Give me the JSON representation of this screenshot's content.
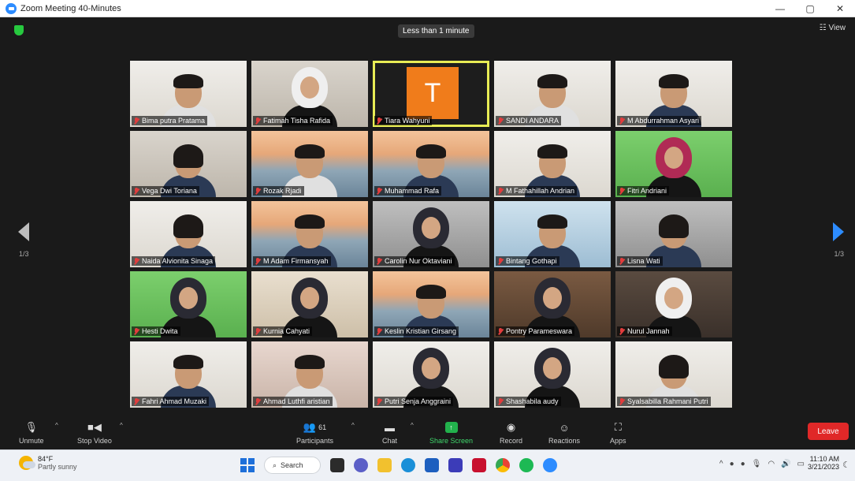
{
  "window": {
    "title": "Zoom Meeting 40-Minutes",
    "minimize": "—",
    "maximize": "▢",
    "close": "✕"
  },
  "meeting": {
    "timer": "Less than 1 minute",
    "view_label": "View",
    "page_left": "1/3",
    "page_right": "1/3"
  },
  "participants": [
    {
      "name": "Bima putra Pratama",
      "bg": "white",
      "look": "man"
    },
    {
      "name": "Fatimah Tisha Rafida",
      "bg": "room",
      "look": "hijab-white"
    },
    {
      "name": "Tiara Wahyuni",
      "bg": "orange",
      "look": "avatar",
      "avatar_letter": "T",
      "active": true
    },
    {
      "name": "SANDI ANDARA",
      "bg": "white",
      "look": "man"
    },
    {
      "name": "M Abdurrahman Asyari",
      "bg": "white",
      "look": "man"
    },
    {
      "name": "Vega Dwi Toriana",
      "bg": "room",
      "look": "woman"
    },
    {
      "name": "Rozak Rjadi",
      "bg": "bridge",
      "look": "man"
    },
    {
      "name": "Muhammad Rafa",
      "bg": "bridge",
      "look": "man"
    },
    {
      "name": "M Fathahillah Andrian",
      "bg": "white",
      "look": "man"
    },
    {
      "name": "Fitri Andriani",
      "bg": "green",
      "look": "hijab-pink"
    },
    {
      "name": "Naida Alvionita Sinaga",
      "bg": "white",
      "look": "woman"
    },
    {
      "name": "M Adam Firmansyah",
      "bg": "bridge",
      "look": "man"
    },
    {
      "name": "Carolin Nur Oktaviani",
      "bg": "gray",
      "look": "hijab"
    },
    {
      "name": "Bintang Gothapi",
      "bg": "blue",
      "look": "man"
    },
    {
      "name": "Lisna Wati",
      "bg": "gray",
      "look": "woman"
    },
    {
      "name": "Hesti Dwita",
      "bg": "green",
      "look": "hijab"
    },
    {
      "name": "Kurnia Cahyati",
      "bg": "beige",
      "look": "hijab"
    },
    {
      "name": "Keslin Kristian Girsang",
      "bg": "bridge",
      "look": "man"
    },
    {
      "name": "Pontry Parameswara",
      "bg": "brown",
      "look": "hijab"
    },
    {
      "name": "Nurul Jannah",
      "bg": "dark",
      "look": "hijab-white"
    },
    {
      "name": "Fahri Ahmad Muzaki",
      "bg": "white",
      "look": "man"
    },
    {
      "name": "Ahmad Luthfi aristian",
      "bg": "pink",
      "look": "man"
    },
    {
      "name": "Putri Senja Anggraini",
      "bg": "white",
      "look": "hijab"
    },
    {
      "name": "Shashabila audy",
      "bg": "white",
      "look": "hijab"
    },
    {
      "name": "Syalsabilla Rahmani Putri",
      "bg": "white",
      "look": "woman"
    }
  ],
  "toolbar": {
    "unmute": "Unmute",
    "stop_video": "Stop Video",
    "participants": "Participants",
    "participants_count": "61",
    "chat": "Chat",
    "share_screen": "Share Screen",
    "record": "Record",
    "reactions": "Reactions",
    "apps": "Apps",
    "leave": "Leave"
  },
  "taskbar": {
    "temperature": "84°F",
    "condition": "Partly sunny",
    "search": "Search",
    "time": "11:10 AM",
    "date": "3/21/2023"
  },
  "colors": {
    "zoom_blue": "#2D8CFF",
    "active_speaker": "#e8ec55",
    "leave_red": "#e02828",
    "share_green": "#22b14c",
    "avatar_orange": "#f07c1b"
  }
}
